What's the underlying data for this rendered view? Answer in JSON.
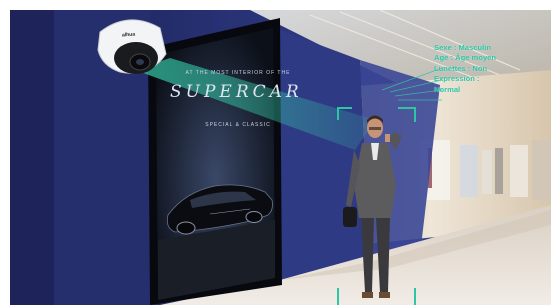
{
  "poster": {
    "tagline": "AT THE MOST INTERIOR OF THE",
    "title": "SUPERCAR",
    "subtitle": "SPECIAL & CLASSIC"
  },
  "camera": {
    "brand": "alhua"
  },
  "detection": {
    "lines": [
      "Sexe : Masculin",
      "Age : Âge moyen",
      "Lunettes : Non",
      "Expression :",
      "Normal"
    ]
  },
  "colors": {
    "overlay_accent": "#2ec5a4",
    "wall_blue": "#2a3476",
    "floor": "#e8e1d8"
  }
}
